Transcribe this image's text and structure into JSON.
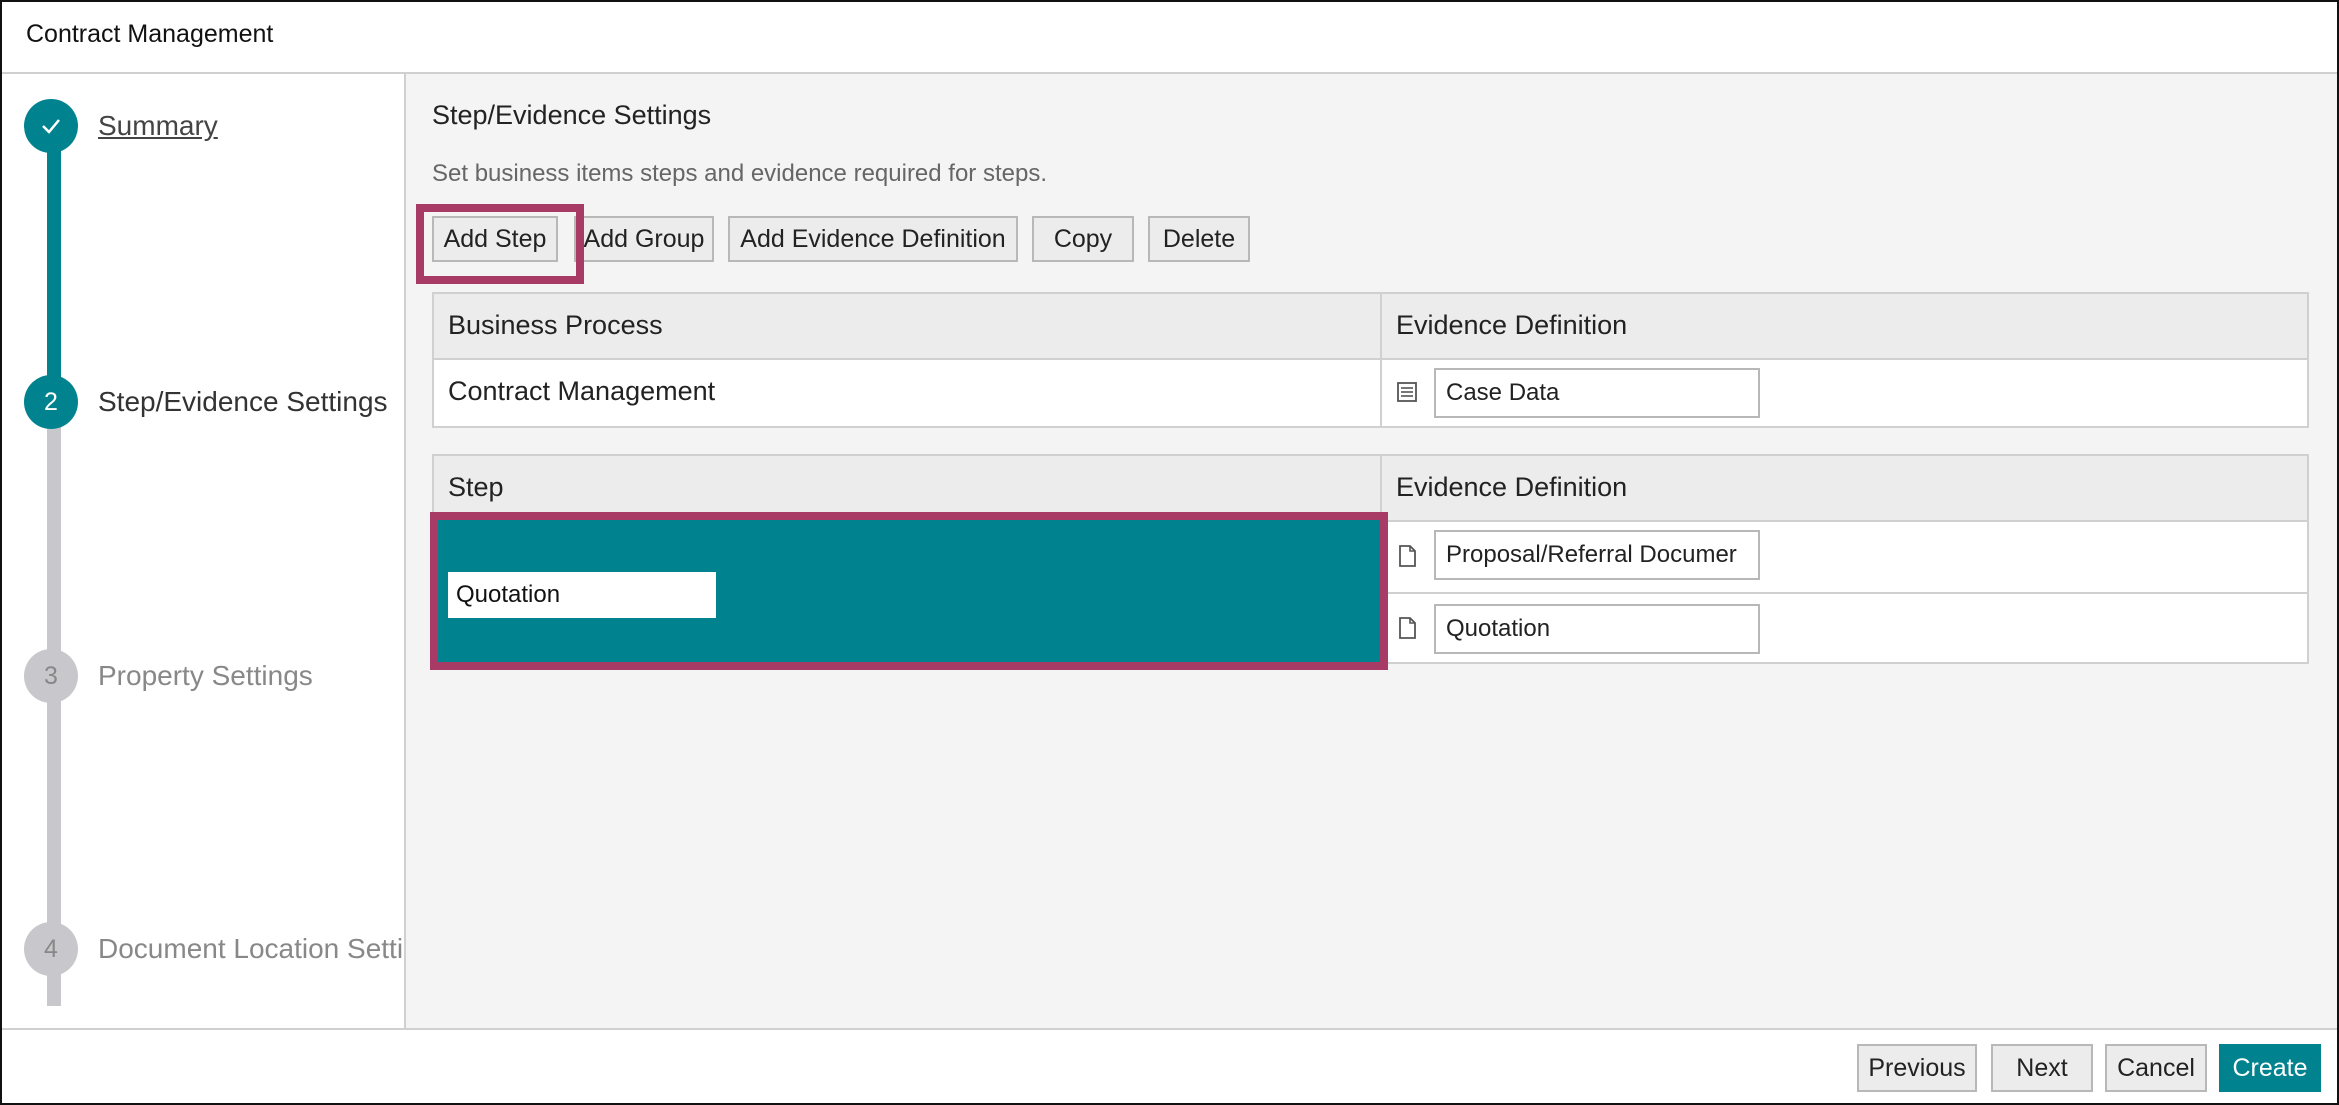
{
  "window": {
    "title": "Contract Management"
  },
  "wizard": {
    "steps": [
      {
        "number": "",
        "label": "Summary",
        "state": "done",
        "icon": "check-icon"
      },
      {
        "number": "2",
        "label": "Step/Evidence Settings",
        "state": "current"
      },
      {
        "number": "3",
        "label": "Property Settings",
        "state": "todo"
      },
      {
        "number": "4",
        "label": "Document Location Setti",
        "state": "todo"
      }
    ]
  },
  "main": {
    "title": "Step/Evidence Settings",
    "description": "Set business items steps and evidence required for steps.",
    "toolbar": {
      "add_step": "Add Step",
      "add_group": "Add Group",
      "add_evidence_definition": "Add Evidence Definition",
      "copy": "Copy",
      "delete": "Delete"
    },
    "process_table": {
      "headers": {
        "col1": "Business Process",
        "col2": "Evidence Definition"
      },
      "row": {
        "process": "Contract Management",
        "evidence": "Case Data",
        "evidence_icon": "list-icon"
      }
    },
    "step_table": {
      "headers": {
        "col1": "Step",
        "col2": "Evidence Definition"
      },
      "row": {
        "step_value": "Quotation",
        "evidence": [
          {
            "label": "Proposal/Referral Documer",
            "icon": "document-icon"
          },
          {
            "label": "Quotation",
            "icon": "document-icon"
          }
        ]
      }
    }
  },
  "footer": {
    "previous": "Previous",
    "next": "Next",
    "cancel": "Cancel",
    "create": "Create"
  },
  "colors": {
    "accent": "#00838f",
    "highlight": "#a83a66",
    "inactive": "#c8c8cc"
  }
}
